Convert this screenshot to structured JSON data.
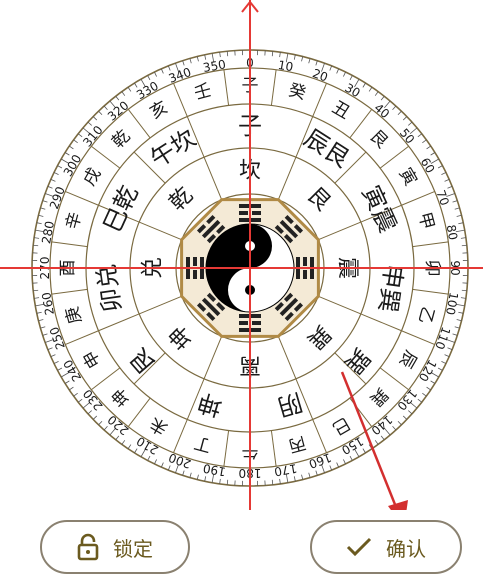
{
  "compass": {
    "bagua_outer": [
      "坎",
      "艮",
      "震",
      "巽",
      "离",
      "坤",
      "兑",
      "乾"
    ],
    "ring_middle": [
      "坎",
      "艮",
      "震",
      "巽",
      "离",
      "坤",
      "兑",
      "乾"
    ],
    "ring_outer": [
      "子",
      "辰艮",
      "寅震",
      "申巽",
      "巽",
      "阴",
      "坤",
      "艮",
      "卯兑",
      "巳乾",
      "午坎"
    ],
    "ring_mountains": [
      "子",
      "癸",
      "丑",
      "艮",
      "寅",
      "甲",
      "卯",
      "乙",
      "辰",
      "巽",
      "巳",
      "丙",
      "午",
      "丁",
      "未",
      "坤",
      "申",
      "庚",
      "酉",
      "辛",
      "戌",
      "乾",
      "亥",
      "壬"
    ],
    "degree_labels": [
      "0",
      "10",
      "20",
      "30",
      "40",
      "50",
      "60",
      "70",
      "80",
      "90",
      "100",
      "110",
      "120",
      "130",
      "140",
      "150",
      "160",
      "170",
      "180",
      "190",
      "200",
      "210",
      "220",
      "230",
      "240",
      "250",
      "260",
      "270",
      "280",
      "290",
      "300",
      "310",
      "320",
      "330",
      "340",
      "350"
    ],
    "colors": {
      "ring": "#7a6a40",
      "crosshair": "#e53935",
      "arrow": "#d32f2f",
      "frame": "#b08a45"
    }
  },
  "buttons": {
    "lock_label": "锁定",
    "lock_icon": "lock-icon",
    "confirm_label": "确认",
    "confirm_icon": "check-icon"
  }
}
